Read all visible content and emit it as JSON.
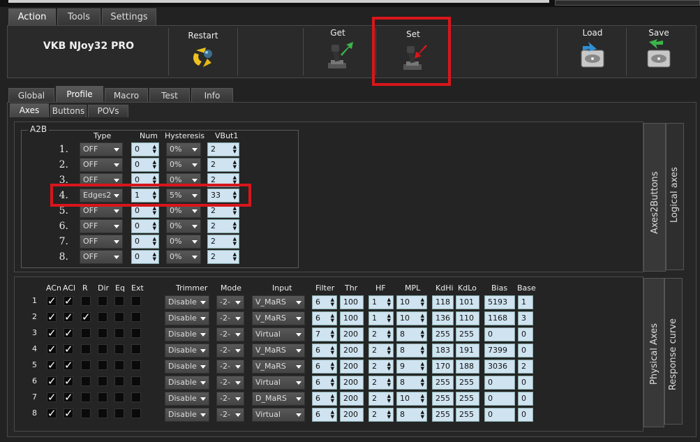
{
  "main_tabs": [
    "Action",
    "Tools",
    "Settings"
  ],
  "device_name": "VKB NJoy32 PRO",
  "toolbar": {
    "restart": "Restart",
    "get": "Get",
    "set": "Set",
    "load": "Load",
    "save": "Save"
  },
  "section_tabs": [
    "Global",
    "Profile",
    "Macro",
    "Test",
    "Info"
  ],
  "sub_tabs": [
    "Axes",
    "Buttons",
    "POVs"
  ],
  "a2b": {
    "title": "A2B",
    "headers": {
      "type": "Type",
      "num": "Num",
      "hysteresis": "Hysteresis",
      "vbut": "VBut1"
    },
    "rows": [
      {
        "n": "1.",
        "type": "OFF",
        "num": "0",
        "hyst": "0%",
        "vbut": "2"
      },
      {
        "n": "2.",
        "type": "OFF",
        "num": "0",
        "hyst": "0%",
        "vbut": "2"
      },
      {
        "n": "3.",
        "type": "OFF",
        "num": "0",
        "hyst": "0%",
        "vbut": "2"
      },
      {
        "n": "4.",
        "type": "Edges2",
        "num": "1",
        "hyst": "5%",
        "vbut": "33"
      },
      {
        "n": "5.",
        "type": "OFF",
        "num": "0",
        "hyst": "0%",
        "vbut": "2"
      },
      {
        "n": "6.",
        "type": "OFF",
        "num": "0",
        "hyst": "0%",
        "vbut": "2"
      },
      {
        "n": "7.",
        "type": "OFF",
        "num": "0",
        "hyst": "0%",
        "vbut": "2"
      },
      {
        "n": "8.",
        "type": "OFF",
        "num": "0",
        "hyst": "0%",
        "vbut": "2"
      }
    ]
  },
  "upper_vtabs": [
    "Axes2Buttons",
    "Logical axes"
  ],
  "lower_vtabs": [
    "Physical Axes",
    "Response curve"
  ],
  "phys": {
    "headers": {
      "acn": "ACn",
      "acl": "ACl",
      "r": "R",
      "dir": "Dir",
      "eq": "Eq",
      "ext": "Ext",
      "trimmer": "Trimmer",
      "mode": "Mode",
      "input": "Input",
      "filter": "Filter",
      "thr": "Thr",
      "hf": "HF",
      "mpl": "MPL",
      "kdhi": "KdHi",
      "kdlo": "KdLo",
      "bias": "Bias",
      "base": "Base"
    },
    "check_mark": "✓",
    "rows": [
      {
        "n": "1",
        "acn": true,
        "acl": true,
        "r": false,
        "trimmer": "Disable",
        "mode": "-2-",
        "input": "V_MaRS",
        "filter": "6",
        "thr": "100",
        "hf": "1",
        "mpl": "10",
        "kdhi": "118",
        "kdlo": "101",
        "bias": "5193",
        "base": "1"
      },
      {
        "n": "2",
        "acn": true,
        "acl": true,
        "r": true,
        "trimmer": "Disable",
        "mode": "-2-",
        "input": "V_MaRS",
        "filter": "6",
        "thr": "100",
        "hf": "1",
        "mpl": "10",
        "kdhi": "136",
        "kdlo": "110",
        "bias": "1168",
        "base": "3"
      },
      {
        "n": "3",
        "acn": true,
        "acl": true,
        "r": false,
        "trimmer": "Disable",
        "mode": "-2-",
        "input": "Virtual",
        "filter": "7",
        "thr": "200",
        "hf": "2",
        "mpl": "8",
        "kdhi": "255",
        "kdlo": "255",
        "bias": "0",
        "base": "0"
      },
      {
        "n": "4",
        "acn": true,
        "acl": true,
        "r": false,
        "trimmer": "Disable",
        "mode": "-2-",
        "input": "V_MaRS",
        "filter": "6",
        "thr": "200",
        "hf": "2",
        "mpl": "8",
        "kdhi": "183",
        "kdlo": "191",
        "bias": "7399",
        "base": "0"
      },
      {
        "n": "5",
        "acn": true,
        "acl": true,
        "r": false,
        "trimmer": "Disable",
        "mode": "-2-",
        "input": "V_MaRS",
        "filter": "6",
        "thr": "200",
        "hf": "2",
        "mpl": "9",
        "kdhi": "170",
        "kdlo": "188",
        "bias": "3036",
        "base": "2"
      },
      {
        "n": "6",
        "acn": true,
        "acl": true,
        "r": false,
        "trimmer": "Disable",
        "mode": "-2-",
        "input": "Virtual",
        "filter": "6",
        "thr": "200",
        "hf": "2",
        "mpl": "8",
        "kdhi": "255",
        "kdlo": "255",
        "bias": "0",
        "base": "0"
      },
      {
        "n": "7",
        "acn": true,
        "acl": true,
        "r": false,
        "trimmer": "Disable",
        "mode": "-2-",
        "input": "D_MaRS",
        "filter": "6",
        "thr": "200",
        "hf": "2",
        "mpl": "10",
        "kdhi": "255",
        "kdlo": "255",
        "bias": "0",
        "base": "0"
      },
      {
        "n": "8",
        "acn": true,
        "acl": true,
        "r": false,
        "trimmer": "Disable",
        "mode": "-2-",
        "input": "Virtual",
        "filter": "6",
        "thr": "200",
        "hf": "2",
        "mpl": "8",
        "kdhi": "255",
        "kdlo": "255",
        "bias": "0",
        "base": "0"
      }
    ]
  },
  "colors": {
    "highlight": "#d8161c",
    "field": "#cfe3f0"
  }
}
